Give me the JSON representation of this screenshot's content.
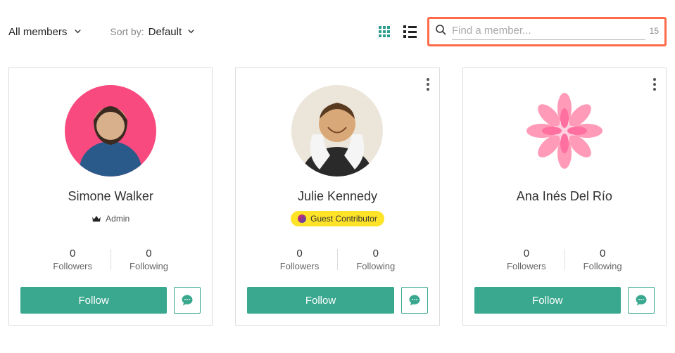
{
  "toolbar": {
    "filter_label": "All members",
    "sort_label": "Sort by:",
    "sort_value": "Default",
    "search_placeholder": "Find a member...",
    "search_count": "15"
  },
  "actions": {
    "follow_label": "Follow"
  },
  "stats_labels": {
    "followers": "Followers",
    "following": "Following"
  },
  "members": [
    {
      "name": "Simone Walker",
      "role_type": "admin",
      "role_label": "Admin",
      "followers": "0",
      "following": "0",
      "show_more": false,
      "avatar_bg": "#f84a7e"
    },
    {
      "name": "Julie Kennedy",
      "role_type": "badge",
      "role_label": "Guest Contributor",
      "followers": "0",
      "following": "0",
      "show_more": true,
      "avatar_bg": "#e8e4dc"
    },
    {
      "name": "Ana Inés Del Río",
      "role_type": "none",
      "role_label": "",
      "followers": "0",
      "following": "0",
      "show_more": true,
      "avatar_bg": "#ffffff"
    }
  ]
}
